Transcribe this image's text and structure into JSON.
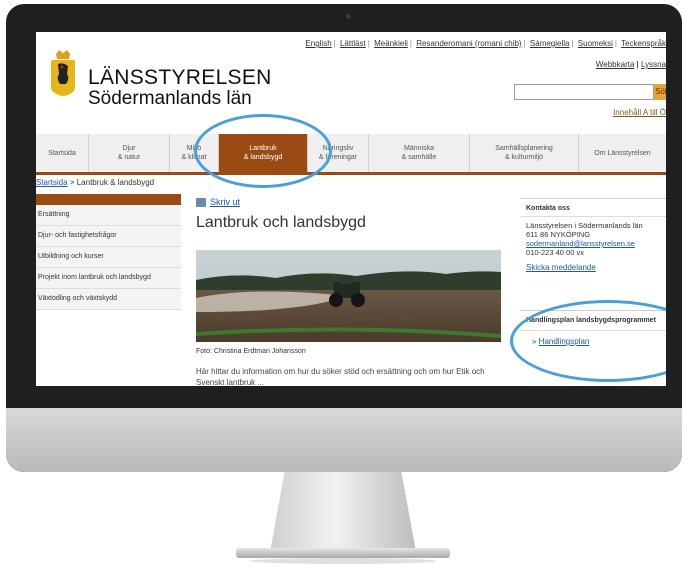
{
  "header": {
    "top_links": [
      "English",
      "Lättläst",
      "Meänkieli",
      "Resanderomani (romani chib)",
      "Sámegiella",
      "Suomeksi",
      "Teckenspråk"
    ],
    "top_links_row2": "Webbkarta",
    "top_links_row2_b": "Lyssna",
    "brand_line1": "LÄNSSTYRELSEN",
    "brand_line2": "Södermanlands län",
    "search_button": "Sök",
    "contents_link": "Innehåll A till Ö"
  },
  "nav": {
    "tabs": [
      {
        "l1": "",
        "l2": "Startsida"
      },
      {
        "l1": "Djur",
        "l2": "& natur"
      },
      {
        "l1": "Miljö",
        "l2": "& klimat"
      },
      {
        "l1": "Lantbruk",
        "l2": "& landsbygd"
      },
      {
        "l1": "Näringsliv",
        "l2": "& föreningar"
      },
      {
        "l1": "Människa",
        "l2": "& samhälle"
      },
      {
        "l1": "Samhällsplanering",
        "l2": "& kulturmiljö"
      },
      {
        "l1": "",
        "l2": "Om Länsstyrelsen"
      }
    ]
  },
  "breadcrumb": {
    "home": "Startsida",
    "separator": ">",
    "current": "Lantbruk & landsbygd"
  },
  "sidebar": {
    "items": [
      "Ersättning",
      "Djur- och fastighetsfrågor",
      "Utbildning och kurser",
      "Projekt inom lantbruk och landsbygd",
      "Växtodling och växtskydd"
    ]
  },
  "main": {
    "print_label": "Skriv ut",
    "title": "Lantbruk och landsbygd",
    "caption": "Foto: Christina Erdtman Johansson",
    "body": "Här hittar du information om hur du söker stöd och ersättning och om hur Etik och Svenskt lantbruk ..."
  },
  "contact": {
    "heading": "Kontakta oss",
    "line1": "Länsstyrelsen i Södermanlands län",
    "line2": "611 86 NYKÖPING",
    "email": "sodermanland@lansstyrelsen.se",
    "phone": "010-223 40 00 vx",
    "send": "Skicka meddelande"
  },
  "plan": {
    "heading": "Handlingsplan landsbygdsprogrammet",
    "link": "Handlingsplan"
  },
  "colors": {
    "brand_brown": "#9a4b14",
    "link_blue": "#1d5aa0",
    "highlight_blue": "#4aa0d6"
  }
}
